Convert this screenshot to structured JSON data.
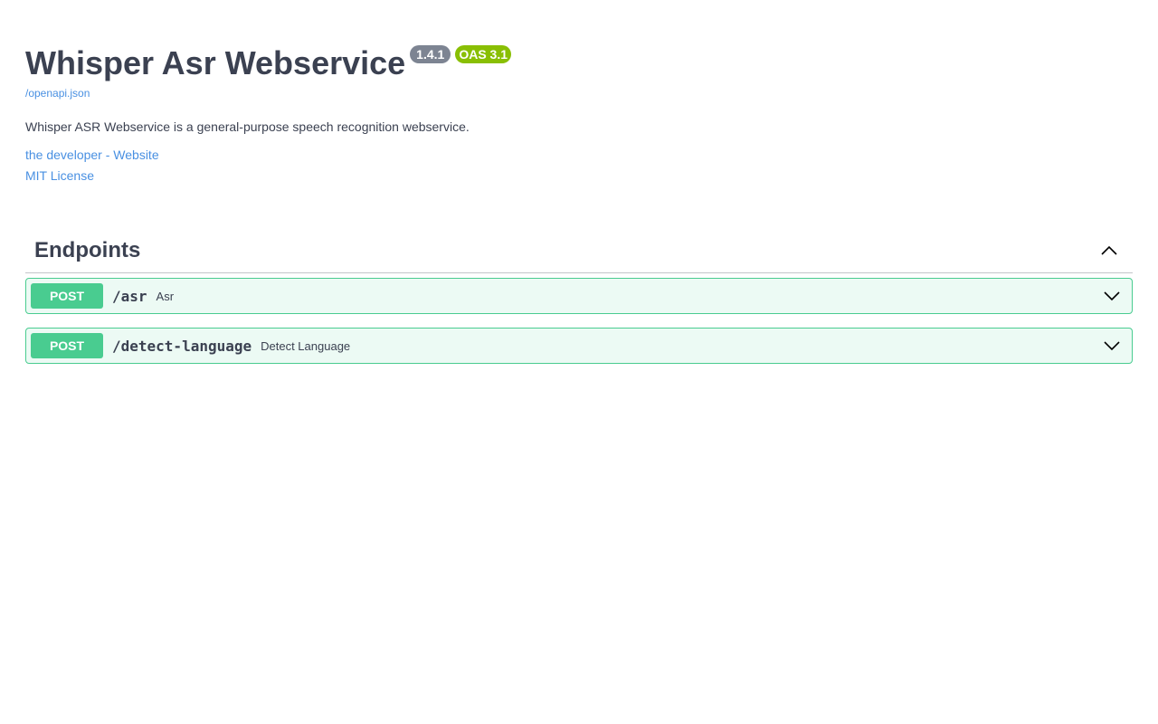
{
  "info": {
    "title": "Whisper Asr Webservice",
    "version_badge": "1.4.1",
    "oas_badge": "OAS 3.1",
    "spec_link": "/openapi.json",
    "description": "Whisper ASR Webservice is a general-purpose speech recognition webservice.",
    "developer_link": "the developer - Website",
    "license_link": "MIT License"
  },
  "section": {
    "title": "Endpoints",
    "collapse_icon": "chevron-up-icon",
    "operations": [
      {
        "method": "POST",
        "path": "/asr",
        "summary": "Asr",
        "icon": "chevron-down-icon"
      },
      {
        "method": "POST",
        "path": "/detect-language",
        "summary": "Detect Language",
        "icon": "chevron-down-icon"
      }
    ]
  },
  "colors": {
    "post": "#49cc90",
    "link": "#4990e2",
    "text": "#3b4151",
    "version_badge": "#7d8492",
    "oas_badge": "#89bf04"
  }
}
